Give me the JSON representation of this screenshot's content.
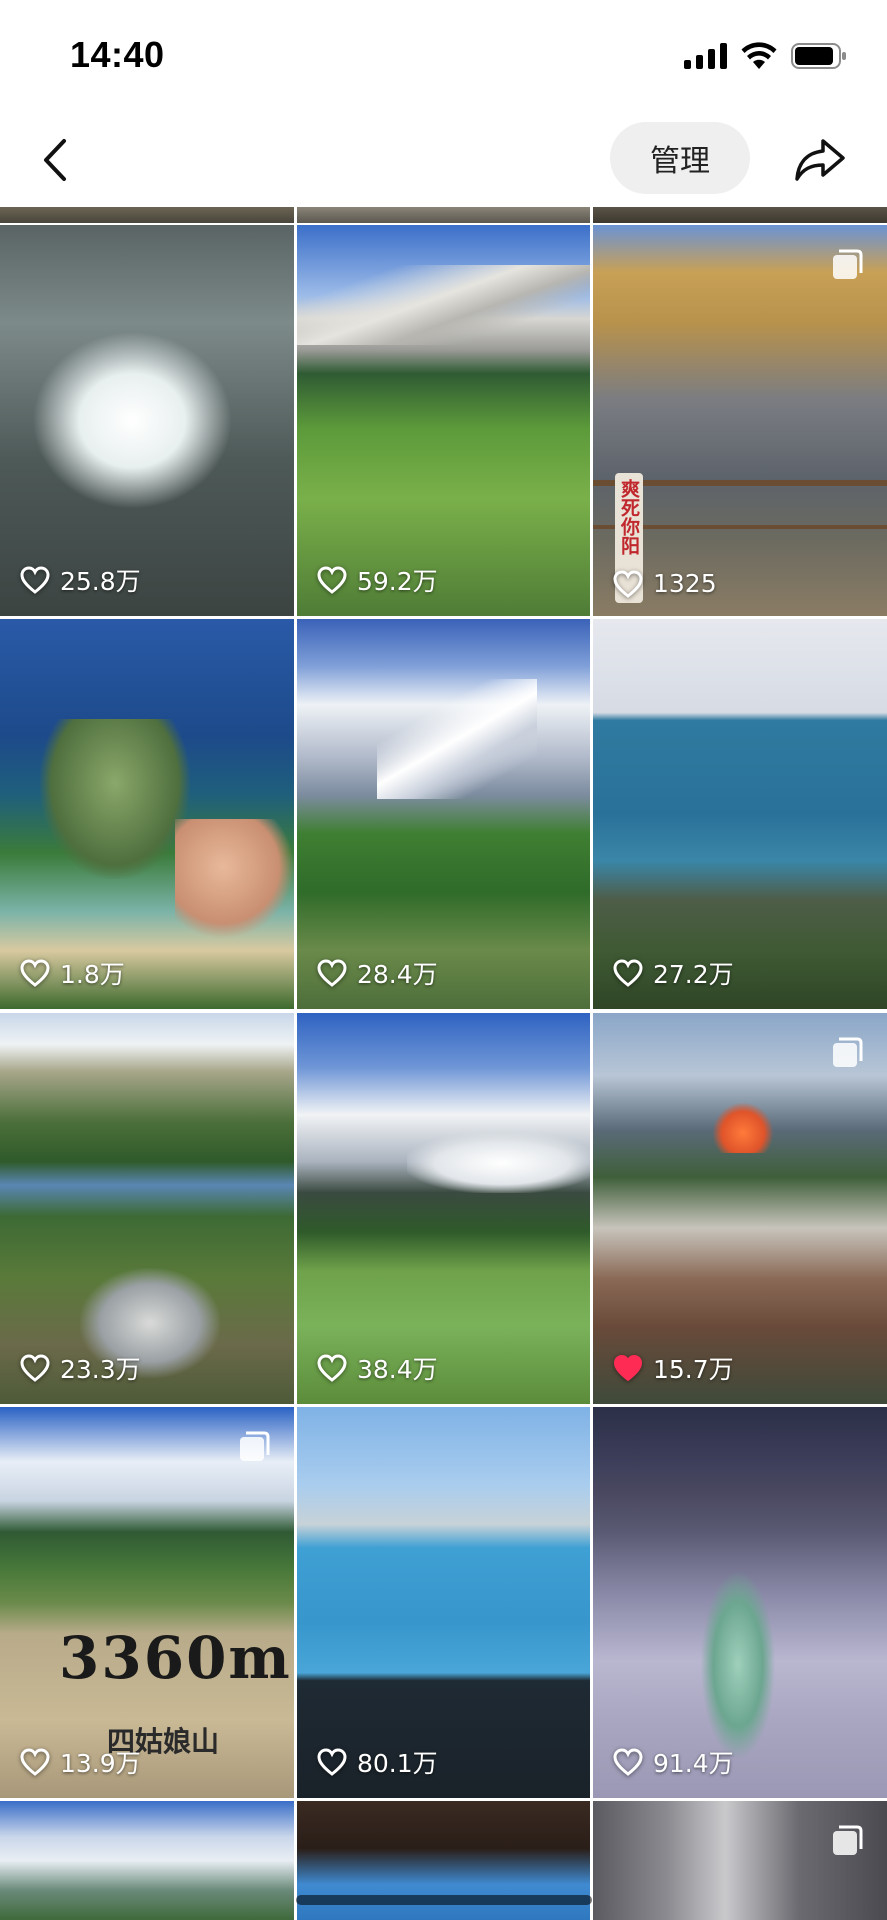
{
  "status_bar": {
    "time": "14:40"
  },
  "nav": {
    "manage_label": "管理"
  },
  "tiles": [
    {
      "likes": "25.8万",
      "liked": false,
      "multi": false
    },
    {
      "likes": "59.2万",
      "liked": false,
      "multi": false
    },
    {
      "likes": "1325",
      "liked": false,
      "multi": true,
      "sign_text": "爽死你阳"
    },
    {
      "likes": "1.8万",
      "liked": false,
      "multi": false
    },
    {
      "likes": "28.4万",
      "liked": false,
      "multi": false
    },
    {
      "likes": "27.2万",
      "liked": false,
      "multi": false
    },
    {
      "likes": "23.3万",
      "liked": false,
      "multi": false
    },
    {
      "likes": "38.4万",
      "liked": false,
      "multi": false
    },
    {
      "likes": "15.7万",
      "liked": true,
      "multi": true
    },
    {
      "likes": "13.9万",
      "liked": false,
      "multi": true,
      "sign_text": "3360m",
      "sign_sub": "四姑娘山"
    },
    {
      "likes": "80.1万",
      "liked": false,
      "multi": false
    },
    {
      "likes": "91.4万",
      "liked": false,
      "multi": false
    }
  ],
  "colors": {
    "liked_heart": "#fe2c55",
    "manage_bg": "#efefef"
  }
}
